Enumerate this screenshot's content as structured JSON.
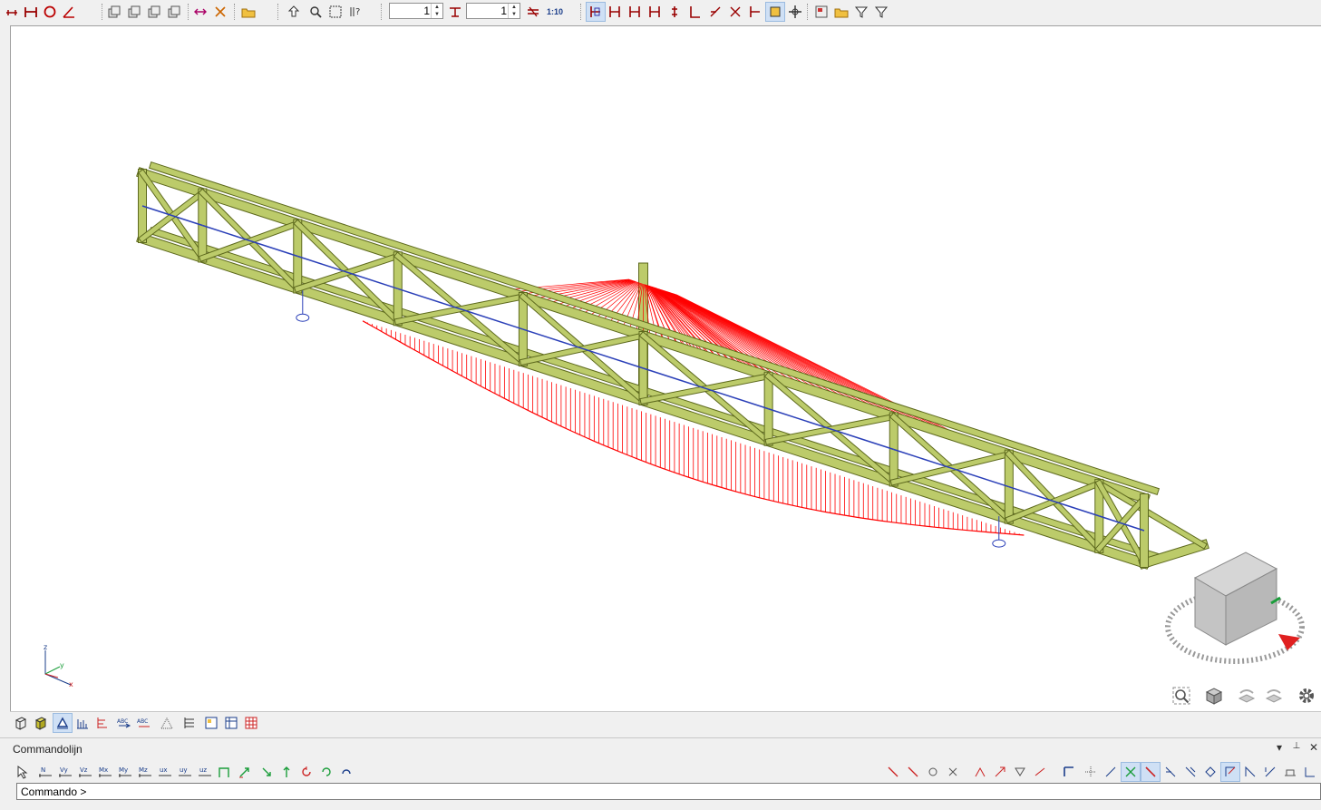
{
  "toolbar": {
    "load_case_value": "1",
    "combination_value": "1",
    "scale_label": "1:10",
    "buttons": [
      "node-icon",
      "beam-icon",
      "circle-icon",
      "angle-icon",
      "copy-icon",
      "copy2-icon",
      "copy3-icon",
      "copy4-icon",
      "mirror-icon",
      "scissors-icon",
      "open-icon",
      "import-icon",
      "zoom-window-icon",
      "zoom-all-icon",
      "dimension-icon",
      "help-icon",
      "loads-icon",
      "results-icon"
    ]
  },
  "viewbar": {
    "buttons": [
      "wireframe-icon",
      "solid-icon",
      "supports-icon",
      "loads-view-icon",
      "diagram-icon",
      "abc-labels-icon",
      "abc-numbers-icon",
      "mesh-icon",
      "table-icon",
      "report-icon",
      "layer-icon",
      "grid-icon"
    ]
  },
  "command_panel": {
    "title": "Commandolijn",
    "tools": [
      "N",
      "Vy",
      "Vz",
      "Mx",
      "My",
      "Mz",
      "ux",
      "uy",
      "uz"
    ],
    "prompt": "Commando >"
  },
  "axis_triad": {
    "x": "x",
    "y": "y",
    "z": "z"
  },
  "colors": {
    "member": "#bccb6a",
    "member_edge": "#5e6a1e",
    "diagram": "#ff0000",
    "brace": "#2a3fb8",
    "accent": "#cfe0f5"
  }
}
